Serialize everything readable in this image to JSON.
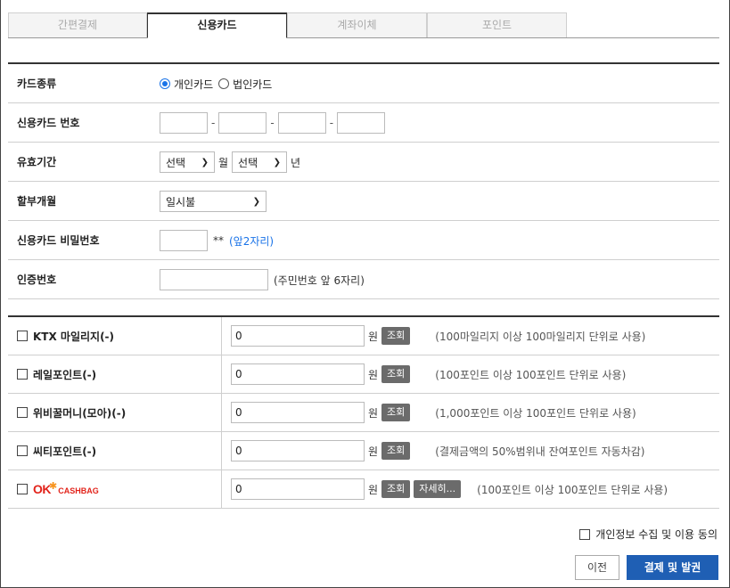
{
  "tabs": [
    {
      "label": "간편결제",
      "active": false
    },
    {
      "label": "신용카드",
      "active": true
    },
    {
      "label": "계좌이체",
      "active": false
    },
    {
      "label": "포인트",
      "active": false
    }
  ],
  "card_form": {
    "card_type": {
      "label": "카드종류",
      "options": [
        {
          "label": "개인카드",
          "selected": true
        },
        {
          "label": "법인카드",
          "selected": false
        }
      ]
    },
    "card_number": {
      "label": "신용카드 번호",
      "separator": "-",
      "values": [
        "",
        "",
        "",
        ""
      ]
    },
    "expiry": {
      "label": "유효기간",
      "month_select": "선택",
      "month_unit": "월",
      "year_select": "선택",
      "year_unit": "년"
    },
    "installment": {
      "label": "할부개월",
      "value": "일시불"
    },
    "password": {
      "label": "신용카드 비밀번호",
      "suffix": "**",
      "hint": "(앞2자리)"
    },
    "auth": {
      "label": "인증번호",
      "hint": "(주민번호 앞 6자리)"
    }
  },
  "points": [
    {
      "label": "KTX 마일리지(-)",
      "value": "0",
      "unit": "원",
      "button": "조회",
      "note": "(100마일리지 이상 100마일리지 단위로 사용)"
    },
    {
      "label": "레일포인트(-)",
      "value": "0",
      "unit": "원",
      "button": "조회",
      "note": "(100포인트 이상 100포인트 단위로 사용)"
    },
    {
      "label": "위비꿀머니(모아)(-)",
      "value": "0",
      "unit": "원",
      "button": "조회",
      "note": "(1,000포인트 이상 100포인트 단위로 사용)"
    },
    {
      "label": "씨티포인트(-)",
      "value": "0",
      "unit": "원",
      "button": "조회",
      "note": "(결제금액의 50%범위내 잔여포인트 자동차감)"
    },
    {
      "label": "OK CASHBAG",
      "logo_ok": "OK",
      "logo_cash": "CASHBAG",
      "value": "0",
      "unit": "원",
      "button": "조회",
      "detail_button": "자세히...",
      "note": "(100포인트 이상 100포인트 단위로 사용)"
    }
  ],
  "footer": {
    "agree_label": "개인정보 수집 및 이용 동의",
    "prev_button": "이전",
    "pay_button": "결제 및 발권"
  },
  "colors": {
    "accent": "#1a73e8",
    "pay_button": "#1f5fb4",
    "ok_red": "#e2231a"
  }
}
